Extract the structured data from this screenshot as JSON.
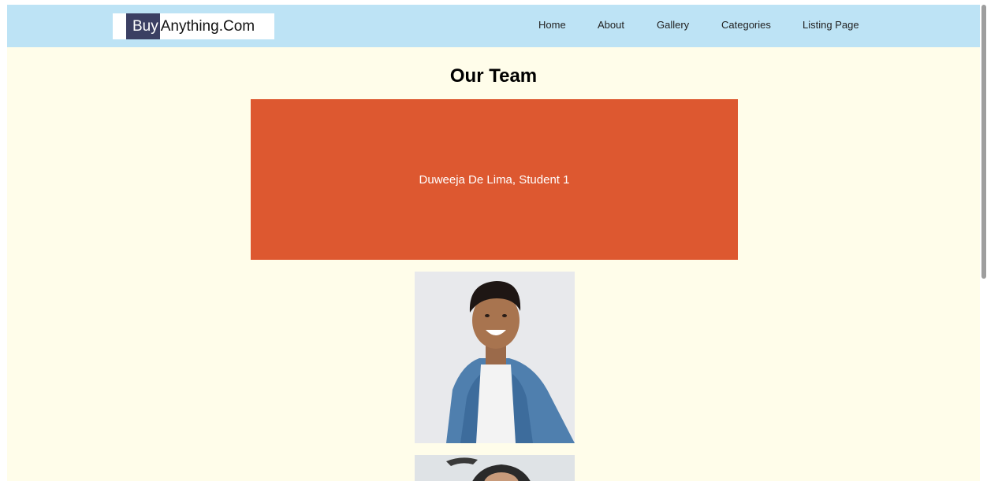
{
  "header": {
    "brand_highlight": "Buy",
    "brand_rest": "Anything.Com",
    "nav": [
      {
        "label": "Home"
      },
      {
        "label": "About"
      },
      {
        "label": "Gallery"
      },
      {
        "label": "Categories"
      },
      {
        "label": "Listing Page"
      }
    ]
  },
  "main": {
    "title": "Our Team",
    "cards": [
      {
        "caption": "Duweeja De Lima, Student 1"
      }
    ]
  },
  "colors": {
    "navbar": "#bde3f5",
    "page_background": "#fffdea",
    "card": "#dd5830",
    "brand_highlight": "#3b3f63"
  }
}
